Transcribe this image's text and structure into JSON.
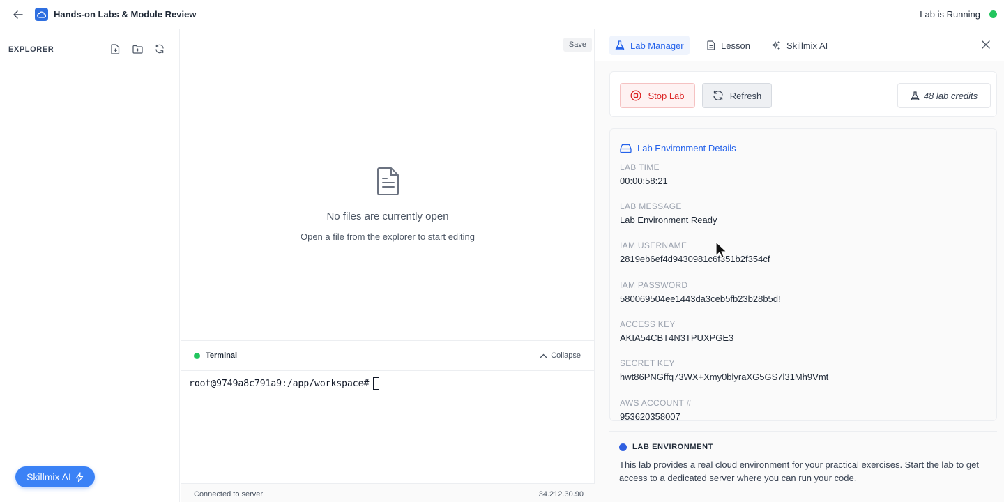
{
  "header": {
    "title": "Hands-on Labs & Module Review",
    "status_text": "Lab is Running",
    "status_color": "#22c55e"
  },
  "explorer": {
    "title": "EXPLORER",
    "actions": [
      "new-file-icon",
      "new-folder-icon",
      "refresh-icon"
    ],
    "fab_label": "Skillmix AI"
  },
  "editor": {
    "save_label": "Save",
    "empty_title": "No files are currently open",
    "empty_subtitle": "Open a file from the explorer to start editing"
  },
  "terminal": {
    "title": "Terminal",
    "collapse_label": "Collapse",
    "prompt": "root@9749a8c791a9:/app/workspace#",
    "connection_status": "Connected to server",
    "server_ip": "34.212.30.90"
  },
  "panel": {
    "tabs": [
      {
        "label": "Lab Manager",
        "icon": "flask-icon",
        "active": true
      },
      {
        "label": "Lesson",
        "icon": "document-icon",
        "active": false
      },
      {
        "label": "Skillmix AI",
        "icon": "sparkles-icon",
        "active": false
      }
    ],
    "stop_label": "Stop Lab",
    "refresh_label": "Refresh",
    "credits_label": "48 lab credits",
    "details_title": "Lab Environment Details",
    "fields": [
      {
        "label": "LAB TIME",
        "value": "00:00:58:21"
      },
      {
        "label": "LAB MESSAGE",
        "value": "Lab Environment Ready"
      },
      {
        "label": "IAM USERNAME",
        "value": "2819eb6ef4d9430981c6f351b2f354cf"
      },
      {
        "label": "IAM PASSWORD",
        "value": "580069504ee1443da3ceb5fb23b28b5d!"
      },
      {
        "label": "ACCESS KEY",
        "value": "AKIA54CBT4N3TPUXPGE3"
      },
      {
        "label": "SECRET KEY",
        "value": "hwt86PNGffq73WX+Xmy0blyraXG5GS7l31Mh9Vmt"
      },
      {
        "label": "AWS ACCOUNT #",
        "value": "953620358007"
      }
    ],
    "info_title": "LAB ENVIRONMENT",
    "info_text": "This lab provides a real cloud environment for your practical exercises. Start the lab to get access to a dedicated server where you can run your code."
  }
}
